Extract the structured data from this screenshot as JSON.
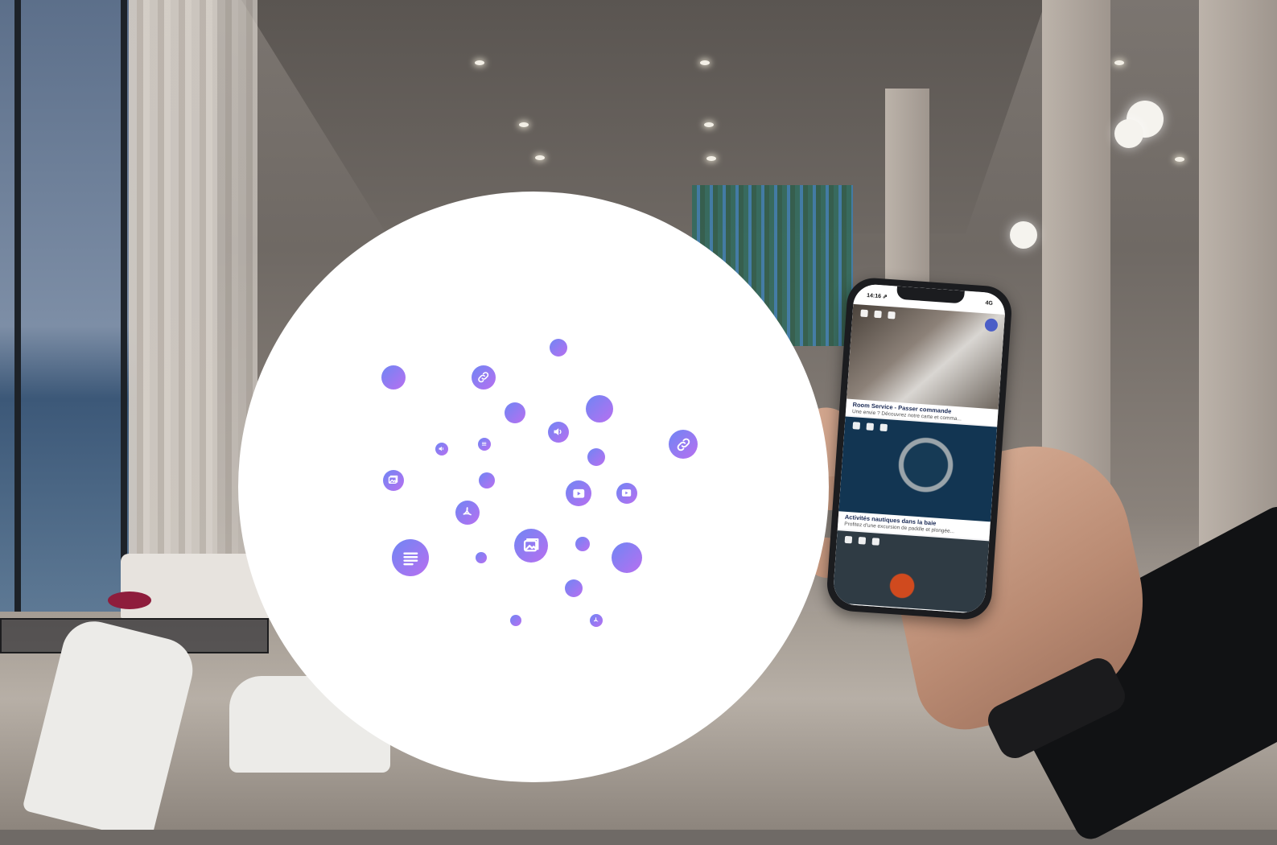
{
  "colors": {
    "bubble_gradient_start": "#6f86f4",
    "bubble_gradient_end": "#b86ff0",
    "circle": "#ffffff",
    "phone_title": "#1a2a55"
  },
  "bubbles": [
    {
      "icon": "dot-icon"
    },
    {
      "icon": "dot-icon"
    },
    {
      "icon": "link-icon"
    },
    {
      "icon": "dot-icon"
    },
    {
      "icon": "dot-icon"
    },
    {
      "icon": "volume-icon"
    },
    {
      "icon": "link-icon"
    },
    {
      "icon": "volume-icon"
    },
    {
      "icon": "list-icon"
    },
    {
      "icon": "dot-icon"
    },
    {
      "icon": "image-icon"
    },
    {
      "icon": "dot-icon"
    },
    {
      "icon": "video-icon"
    },
    {
      "icon": "video-icon"
    },
    {
      "icon": "pdf-icon"
    },
    {
      "icon": "text-icon"
    },
    {
      "icon": "dot-icon"
    },
    {
      "icon": "image-icon"
    },
    {
      "icon": "dot-icon"
    },
    {
      "icon": "dot-icon"
    },
    {
      "icon": "dot-icon"
    },
    {
      "icon": "dot-icon"
    },
    {
      "icon": "pdf-icon"
    }
  ],
  "phone": {
    "status": {
      "time": "14:16 ⇗",
      "network": "4G"
    },
    "cards": [
      {
        "title": "Room Service - Passer commande",
        "description": "Une envie ? Découvrez notre carte et comma..."
      },
      {
        "title": "Activités nautiques dans la baie",
        "description": "Profitez d'une excursion de paddle et plongée..."
      },
      {
        "title": "",
        "description": ""
      }
    ]
  }
}
